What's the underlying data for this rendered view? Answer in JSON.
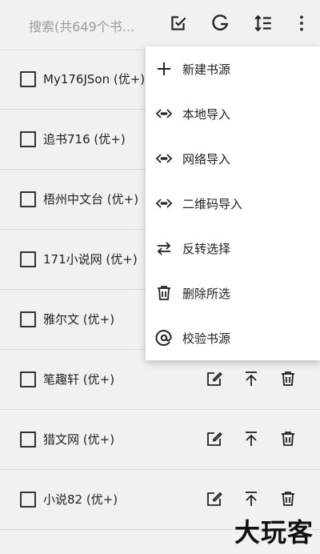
{
  "toolbar": {
    "search_placeholder": "搜索(共649个书...",
    "icons": [
      "select-icon",
      "group-icon",
      "sort-icon",
      "more-icon"
    ]
  },
  "sources": [
    {
      "name": "My176JSon (优+)"
    },
    {
      "name": "追书716 (优+)"
    },
    {
      "name": "梧州中文台 (优+)"
    },
    {
      "name": "171小说网 (优+)"
    },
    {
      "name": "雅尔文 (优+)"
    },
    {
      "name": "笔趣轩 (优+)"
    },
    {
      "name": "猎文网 (优+)"
    },
    {
      "name": "小说82 (优+)"
    }
  ],
  "menu": {
    "items": [
      {
        "label": "新建书源",
        "icon": "plus-icon"
      },
      {
        "label": "本地导入",
        "icon": "import-icon"
      },
      {
        "label": "网络导入",
        "icon": "import-icon"
      },
      {
        "label": "二维码导入",
        "icon": "import-icon"
      },
      {
        "label": "反转选择",
        "icon": "swap-icon"
      },
      {
        "label": "删除所选",
        "icon": "delete-icon"
      },
      {
        "label": "校验书源",
        "icon": "check-source-icon"
      }
    ]
  },
  "watermark": "大玩客"
}
